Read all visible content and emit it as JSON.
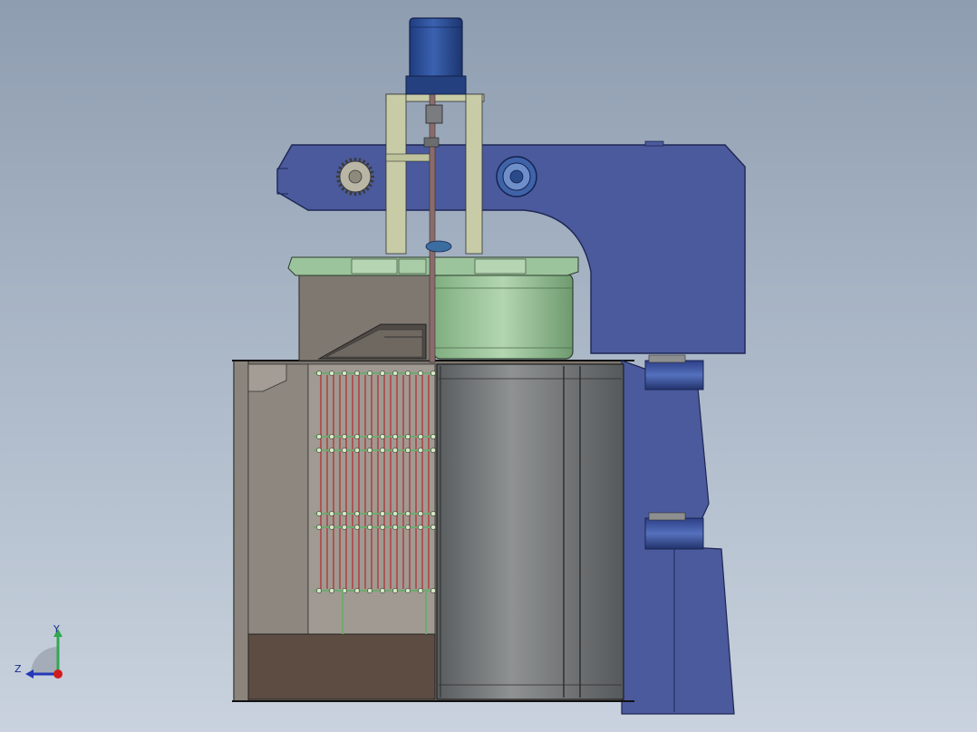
{
  "viewport": {
    "background_top": "#8e9db0",
    "background_bottom": "#c9d2de"
  },
  "model": {
    "motor_color": "#2f4f96",
    "frame_color": "#4a5a9c",
    "tank_color": "#7d766e",
    "drum_color": "#9cc49c",
    "electrode_wire_color": "#b03a3a",
    "electrode_rail_color": "#6faa6f",
    "cylinder_color": "#6e7070"
  },
  "triad": {
    "y_label": "Y",
    "z_label": "Z",
    "y_axis_color": "#2fa84f",
    "z_axis_color": "#2437b8",
    "x_point_color": "#d21c1c"
  }
}
